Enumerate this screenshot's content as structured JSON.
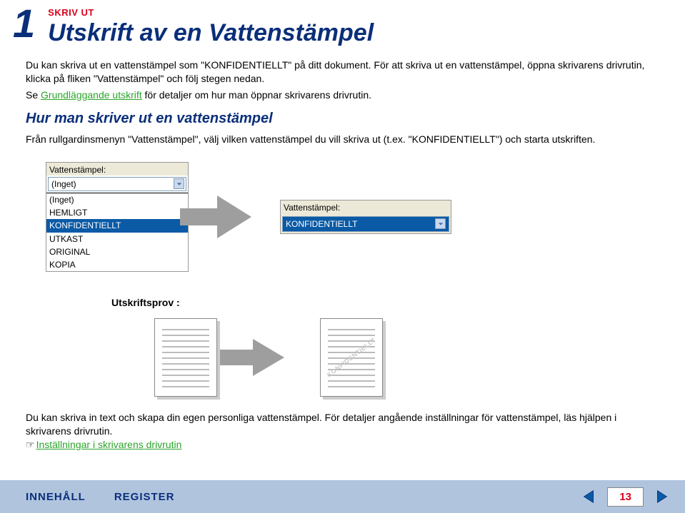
{
  "header": {
    "chapter_number": "1",
    "breadcrumb": "SKRIV UT",
    "title": "Utskrift av en Vattenstämpel"
  },
  "intro": {
    "p1": "Du kan skriva ut en vattenstämpel som \"KONFIDENTIELLT\" på ditt dokument. För att skriva ut en vattenstämpel, öppna skrivarens drivrutin, klicka på fliken \"Vattenstämpel\" och följ stegen nedan.",
    "p2_prefix": "Se ",
    "p2_link": "Grundläggande utskrift",
    "p2_suffix": " för detaljer om hur man öppnar skrivarens drivrutin."
  },
  "section": {
    "heading": "Hur man skriver ut en vattenstämpel",
    "body": "Från rullgardinsmenyn \"Vattenstämpel\", välj vilken vattenstämpel du vill skriva ut (t.ex. \"KONFIDENTIELLT\") och starta utskriften."
  },
  "dropdown": {
    "label": "Vattenstämpel:",
    "selected_top": "(Inget)",
    "items": {
      "0": "(Inget)",
      "1": "HEMLIGT",
      "2": "KONFIDENTIELLT",
      "3": "UTKAST",
      "4": "ORIGINAL",
      "5": "KOPIA"
    },
    "result_label": "Vattenstämpel:",
    "result_value": "KONFIDENTIELLT"
  },
  "sample": {
    "label": "Utskriftsprov :",
    "watermark": "KONFIDENTIELLT"
  },
  "footnote": {
    "text": "Du kan skriva in text och skapa din egen personliga vattenstämpel.  För detaljer angående inställningar för vattenstämpel, läs hjälpen i skrivarens drivrutin.",
    "link": "Inställningar i skrivarens drivrutin"
  },
  "footer": {
    "btn_contents": "INNEHÅLL",
    "btn_index": "REGISTER",
    "page_number": "13"
  }
}
